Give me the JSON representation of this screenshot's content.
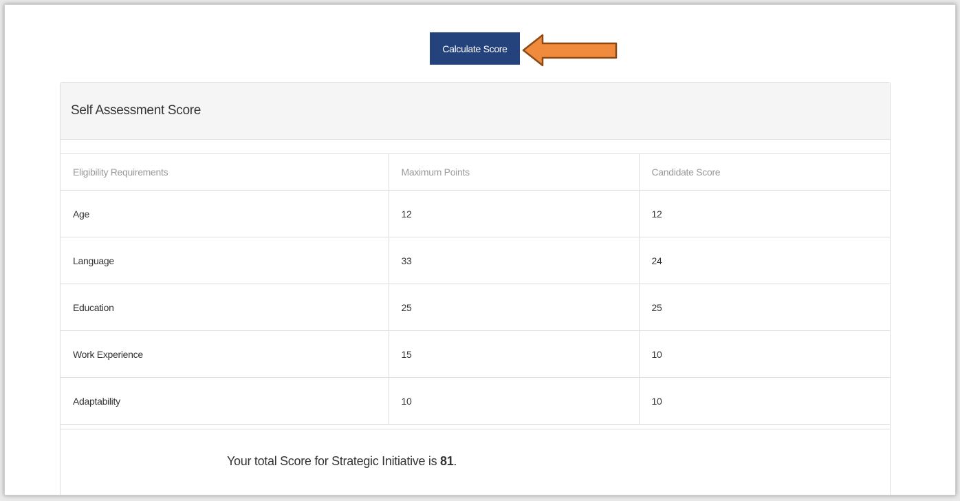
{
  "toolbar": {
    "calculate_label": "Calculate Score"
  },
  "panel": {
    "title": "Self Assessment Score"
  },
  "table": {
    "headers": [
      "Eligibility Requirements",
      "Maximum Points",
      "Candidate Score"
    ],
    "rows": [
      [
        "Age",
        "12",
        "12"
      ],
      [
        "Language",
        "33",
        "24"
      ],
      [
        "Education",
        "25",
        "25"
      ],
      [
        "Work Experience",
        "15",
        "10"
      ],
      [
        "Adaptability",
        "10",
        "10"
      ]
    ]
  },
  "total": {
    "prefix": "Your total Score for Strategic Initiative is ",
    "value": "81",
    "suffix": "."
  },
  "icons": {
    "arrow": "arrow-left-icon"
  },
  "colors": {
    "button_bg": "#24427c",
    "arrow_fill": "#f08a3c",
    "arrow_stroke": "#8a4a16"
  }
}
